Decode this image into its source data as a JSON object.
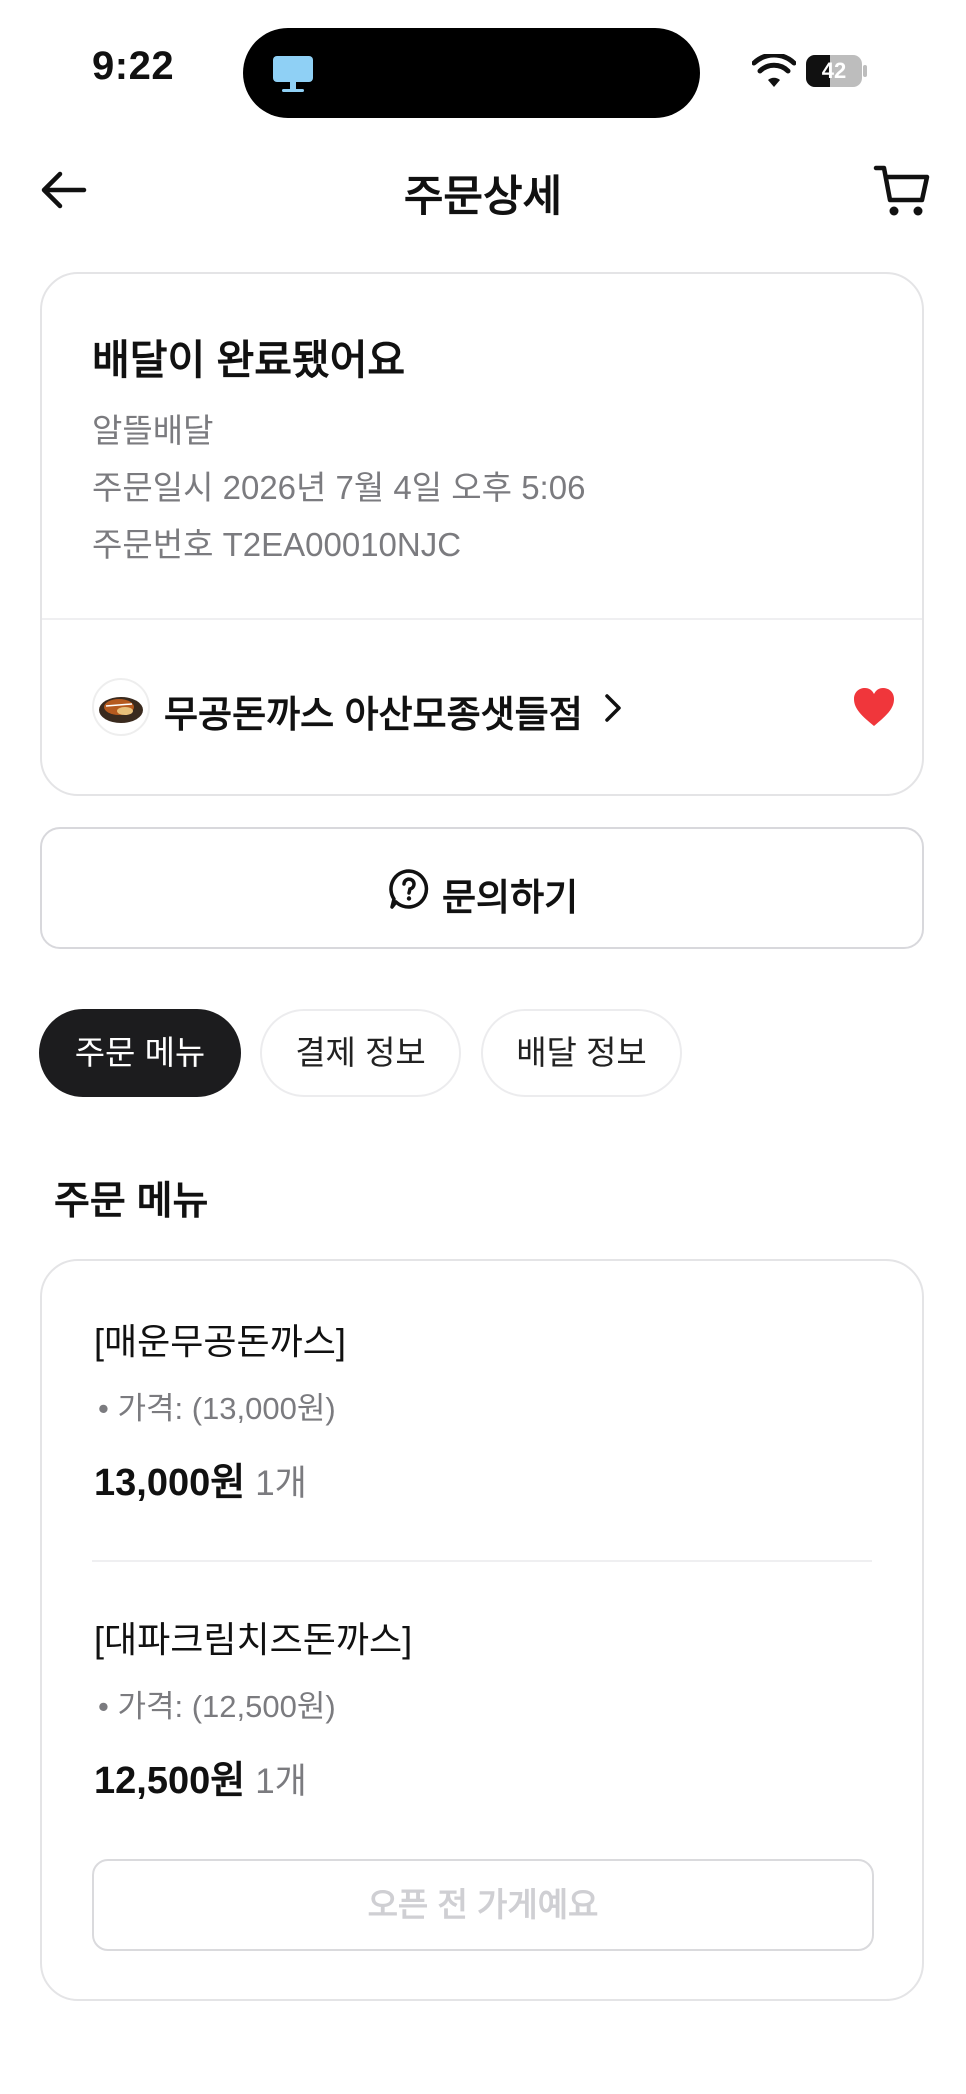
{
  "status_bar": {
    "time": "9:22",
    "battery": "42",
    "battery_level": 0.42
  },
  "header": {
    "title": "주문상세"
  },
  "order_status": {
    "title": "배달이 완료됐어요",
    "delivery_type": "알뜰배달",
    "order_datetime": "주문일시 2026년 7월 4일 오후 5:06",
    "order_number": "주문번호 T2EA00010NJC",
    "store_name": "무공돈까스 아산모종샛들점"
  },
  "inquiry_button": {
    "label": "문의하기"
  },
  "tabs": [
    {
      "label": "주문 메뉴",
      "active": true
    },
    {
      "label": "결제 정보",
      "active": false
    },
    {
      "label": "배달 정보",
      "active": false
    }
  ],
  "section_title": "주문 메뉴",
  "menu_items": [
    {
      "name": "[매운무공돈까스]",
      "price_detail": "• 가격:  (13,000원)",
      "price": "13,000원",
      "quantity": "1개"
    },
    {
      "name": "[대파크림치즈돈까스]",
      "price_detail": "• 가격:  (12,500원)",
      "price": "12,500원",
      "quantity": "1개"
    }
  ],
  "closed_button": {
    "label": "오픈 전 가게예요"
  },
  "colors": {
    "accent_heart": "#f0363b",
    "tab_active_bg": "#1c1c1e",
    "muted_text": "#7b7b7f"
  }
}
